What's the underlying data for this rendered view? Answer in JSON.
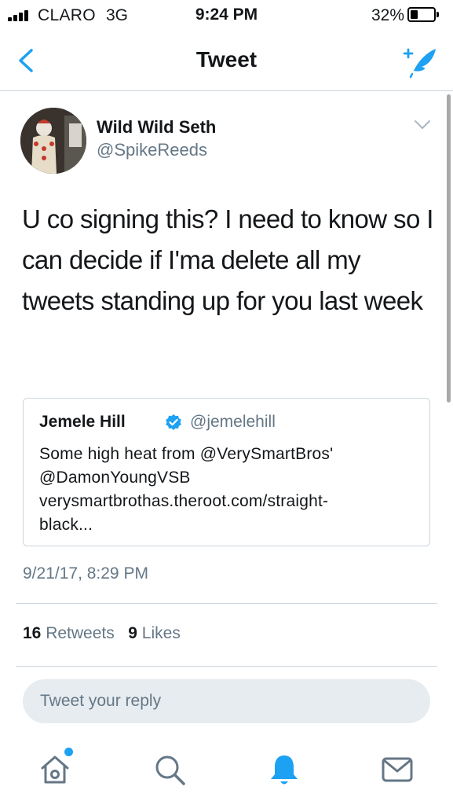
{
  "status_bar": {
    "carrier": "CLARO",
    "network": "3G",
    "time": "9:24 PM",
    "battery_percent": "32%",
    "battery_level": 0.32
  },
  "nav": {
    "title": "Tweet",
    "back_icon": "chevron-left-icon",
    "compose_icon": "compose-tweet-icon"
  },
  "tweet": {
    "author_name": "Wild Wild Seth",
    "author_handle": "@SpikeReeds",
    "text": "U co signing this? I need to know so I can decide if I'ma delete all my tweets standing up for you last week",
    "timestamp": "9/21/17, 8:29 PM",
    "quote": {
      "author_name": "Jemele Hill",
      "author_handle": "@jemelehill",
      "verified": true,
      "text_lines": [
        "Some high heat from @VerySmartBros'",
        "@DamonYoungVSB",
        "verysmartbrothas.theroot.com/straight-",
        "black..."
      ]
    },
    "stats": {
      "retweets_count": "16",
      "retweets_label": "Retweets",
      "likes_count": "9",
      "likes_label": "Likes"
    }
  },
  "reply": {
    "placeholder": "Tweet your reply"
  },
  "tab_bar": {
    "items": [
      "home-icon",
      "search-icon",
      "notifications-icon",
      "messages-icon"
    ],
    "active": "notifications-icon",
    "accent_color": "#1da1f2"
  }
}
